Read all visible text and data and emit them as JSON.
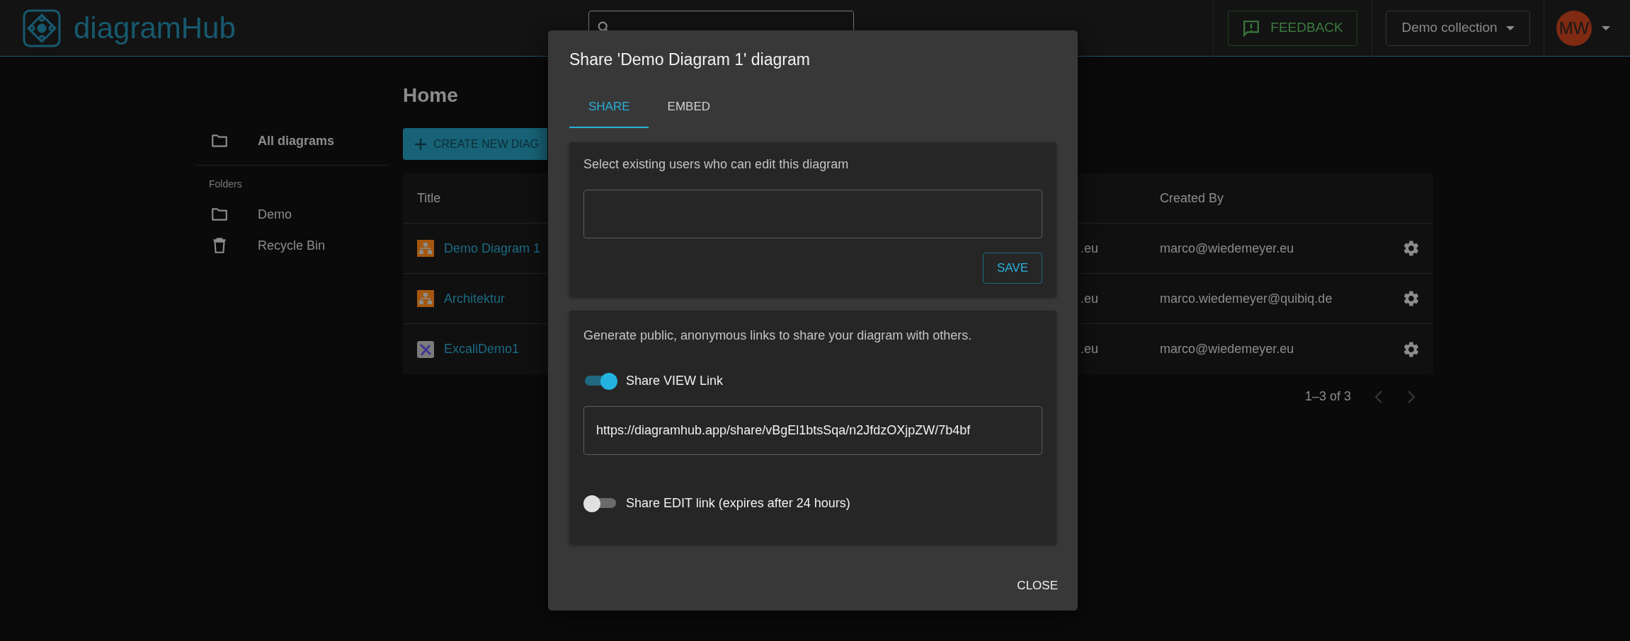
{
  "header": {
    "logo_text": "diagramHub",
    "feedback_button": "FEEDBACK",
    "collection_select": "Demo collection",
    "avatar_initials": "MW"
  },
  "sidebar": {
    "items": [
      {
        "label": "All diagrams",
        "selected": true
      }
    ],
    "section_label": "Folders",
    "folders": [
      {
        "label": "Demo",
        "kind": "folder"
      },
      {
        "label": "Recycle Bin",
        "kind": "trash"
      }
    ]
  },
  "main": {
    "title": "Home",
    "create_button": "CREATE NEW DIAG",
    "table": {
      "columns": [
        {
          "label": "Title"
        },
        {
          "label": "Created By"
        }
      ],
      "rows": [
        {
          "title": "Demo Diagram 1",
          "kind": "flowchart",
          "column_2": ".eu",
          "created_by": "marco@wiedemeyer.eu"
        },
        {
          "title": "Architektur",
          "kind": "flowchart",
          "column_2": ".eu",
          "created_by": "marco.wiedemeyer@quibiq.de"
        },
        {
          "title": "ExcaliDemo1",
          "kind": "sketch",
          "column_2": ".eu",
          "created_by": "marco@wiedemeyer.eu"
        }
      ]
    },
    "pagination": "1–3 of 3"
  },
  "dialog": {
    "title": "Share 'Demo Diagram 1' diagram",
    "tabs": [
      {
        "label": "SHARE",
        "selected": true
      },
      {
        "label": "EMBED",
        "selected": false
      }
    ],
    "users_section": {
      "prompt": "Select existing users who can edit this diagram",
      "save_button": "SAVE"
    },
    "links_section": {
      "prompt": "Generate public, anonymous links to share your diagram with others.",
      "toggles": [
        {
          "label": "Share VIEW Link",
          "on": true,
          "link": "https://diagramhub.app/share/vBgEl1btsSqa/n2JfdzOXjpZW/7b4bf"
        },
        {
          "label": "Share EDIT link (expires after 24 hours)",
          "on": false
        }
      ]
    },
    "close_button": "CLOSE"
  }
}
